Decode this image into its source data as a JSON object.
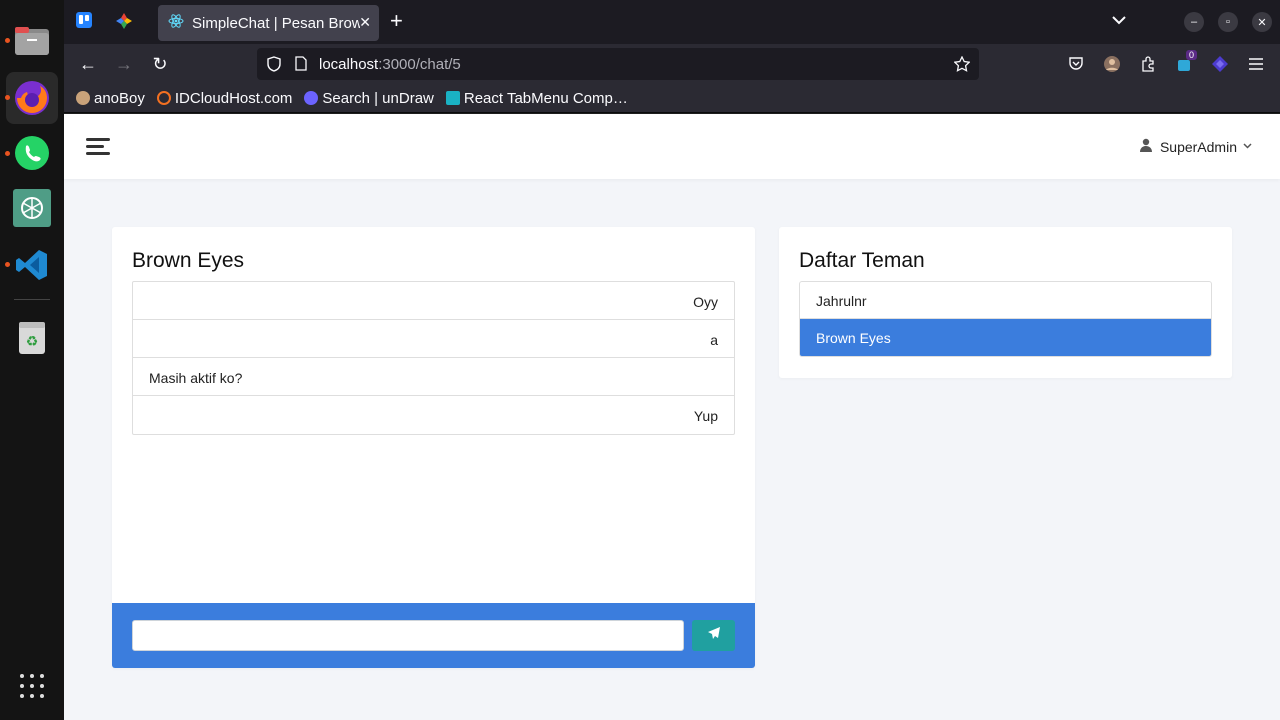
{
  "dock": {
    "apps": [
      "files-icon",
      "firefox-icon",
      "whatsapp-icon",
      "chatgpt-icon",
      "vscode-icon",
      "trash-icon"
    ]
  },
  "browser": {
    "tab_title": "SimpleChat | Pesan Brown Eyes",
    "url_host": "localhost",
    "url_path": ":3000/chat/5",
    "extension_badge": "0",
    "bookmarks": [
      {
        "label": "anoBoy",
        "color": "#c9a27a"
      },
      {
        "label": "IDCloudHost.com",
        "color": "#f37021"
      },
      {
        "label": "Search | unDraw",
        "color": "#6c63ff"
      },
      {
        "label": "React TabMenu Comp…",
        "color": "#1ab2c4"
      }
    ]
  },
  "header": {
    "user_name": "SuperAdmin"
  },
  "chat": {
    "title": "Brown Eyes",
    "messages": [
      {
        "text": "Oyy",
        "align": "right"
      },
      {
        "text": "a",
        "align": "right"
      },
      {
        "text": "Masih aktif ko?",
        "align": "left"
      },
      {
        "text": "Yup",
        "align": "right"
      }
    ],
    "input_value": "",
    "input_placeholder": ""
  },
  "friends": {
    "title": "Daftar Teman",
    "items": [
      {
        "name": "Jahrulnr",
        "active": false
      },
      {
        "name": "Brown Eyes",
        "active": true
      }
    ]
  },
  "colors": {
    "primary": "#3b7ddd",
    "send_button": "#20a0a0",
    "page_bg": "#f3f5f9"
  }
}
